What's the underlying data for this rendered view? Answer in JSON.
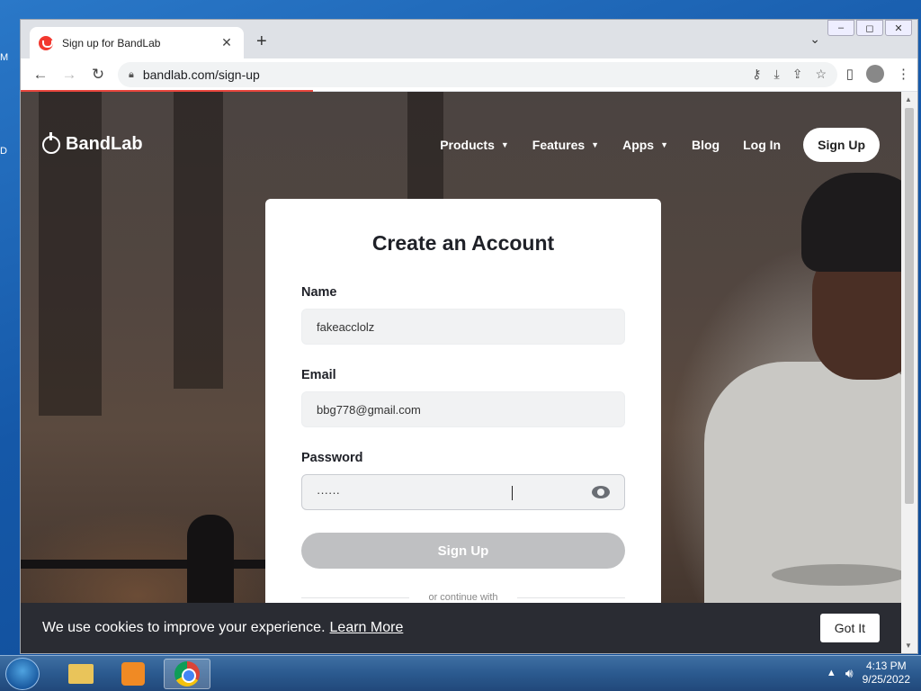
{
  "browser": {
    "tab_title": "Sign up for BandLab",
    "tab_close": "✕",
    "new_tab": "+",
    "tab_menu": "⌄",
    "url": "bandlab.com/sign-up"
  },
  "site": {
    "brand": "BandLab",
    "nav": [
      {
        "label": "Products",
        "has_menu": true
      },
      {
        "label": "Features",
        "has_menu": true
      },
      {
        "label": "Apps",
        "has_menu": true
      },
      {
        "label": "Blog",
        "has_menu": false
      },
      {
        "label": "Log In",
        "has_menu": false
      }
    ],
    "nav_signup": "Sign Up"
  },
  "form": {
    "title": "Create an Account",
    "name_label": "Name",
    "name_value": "fakeacclolz",
    "email_label": "Email",
    "email_value": "bbg778@gmail.com",
    "password_label": "Password",
    "password_value": "······",
    "submit_label": "Sign Up",
    "divider_text": "or continue with"
  },
  "cookie": {
    "text": "We use cookies to improve your experience.",
    "link": "Learn More",
    "button": "Got It"
  },
  "taskbar": {
    "time": "4:13 PM",
    "date": "9/25/2022"
  },
  "colors": {
    "accent": "#f2382f",
    "button_disabled": "#bfc0c2",
    "cookie_bg": "#2a2c33"
  }
}
